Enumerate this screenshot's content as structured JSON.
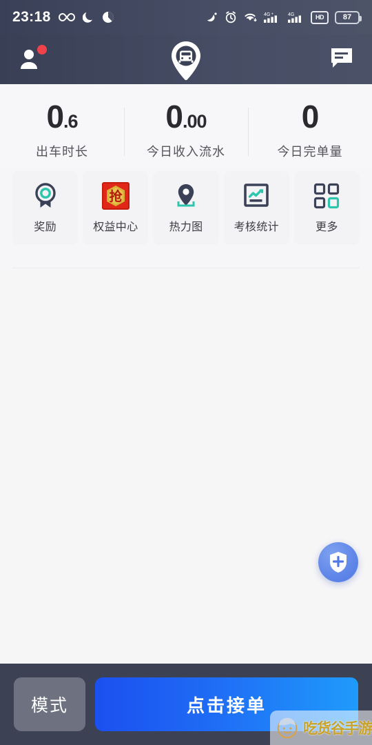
{
  "statusbar": {
    "time": "23:18",
    "icons_left": [
      "infinity-icon",
      "moon-icon",
      "do-not-disturb-icon"
    ],
    "icons_right": [
      "location-satellite-icon",
      "alarm-clock-icon",
      "wifi-icon",
      "signal-4g-plus-icon",
      "signal-4g-icon",
      "hd-voice-icon"
    ],
    "battery_level": "87",
    "hd_label": "HD"
  },
  "appbar": {
    "profile_icon": "person-avatar-icon",
    "has_notification_badge": true,
    "logo_icon": "car-location-pin-logo",
    "message_icon": "message-bubble-icon"
  },
  "stats": [
    {
      "integer": "0",
      "decimal": ".6",
      "label": "出车时长"
    },
    {
      "integer": "0",
      "decimal": ".00",
      "label": "今日收入流水"
    },
    {
      "integer": "0",
      "decimal": "",
      "label": "今日完单量"
    }
  ],
  "tiles": [
    {
      "label": "奖励",
      "icon": "award-medal-icon"
    },
    {
      "label": "权益中心",
      "icon": "grab-benefit-icon",
      "icon_char": "抢"
    },
    {
      "label": "热力图",
      "icon": "map-pin-heat-icon"
    },
    {
      "label": "考核统计",
      "icon": "chart-frame-icon"
    },
    {
      "label": "更多",
      "icon": "grid-more-icon"
    }
  ],
  "fab": {
    "icon": "shield-plus-icon"
  },
  "bottombar": {
    "mode_label": "模式",
    "accept_label": "点击接单"
  },
  "watermark": {
    "text": "吃货谷手游",
    "icon": "cartoon-boy-face-icon"
  },
  "colors": {
    "header_dark": "#3c4254",
    "accent_blue": "#1f6cf5",
    "accent_teal": "#2cc6ae",
    "badge_red": "#f0424a",
    "page_bg": "#f7f6f7",
    "tile_bg": "#f3f2f5"
  }
}
